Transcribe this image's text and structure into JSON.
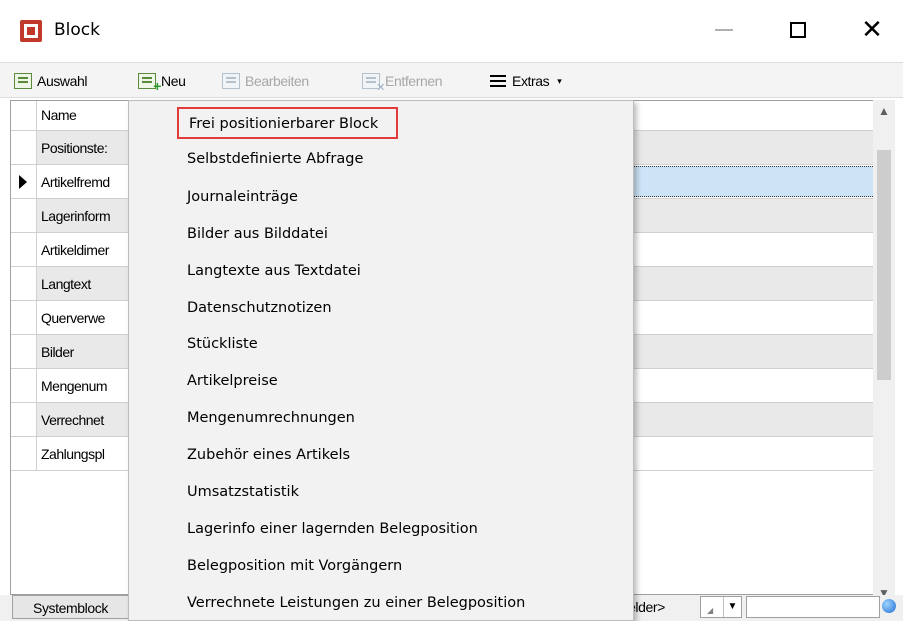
{
  "window": {
    "title": "Block",
    "minimize_label": "Minimize",
    "maximize_label": "Maximize",
    "close_glyph": "✕"
  },
  "toolbar": {
    "items": [
      {
        "label": "Auswahl",
        "icon": "select-icon",
        "enabled": true
      },
      {
        "label": "Neu",
        "icon": "new-icon",
        "enabled": true
      },
      {
        "label": "Bearbeiten",
        "icon": "edit-icon",
        "enabled": false
      },
      {
        "label": "Entfernen",
        "icon": "remove-icon",
        "enabled": false
      },
      {
        "label": "Extras",
        "icon": "menu-icon",
        "enabled": true,
        "has_dropdown": true
      }
    ],
    "extras_caret": "▾"
  },
  "grid": {
    "header": "Name",
    "rows": [
      {
        "name": "Positionste:"
      },
      {
        "name": "Artikelfremd",
        "selected": true
      },
      {
        "name": "Lagerinform"
      },
      {
        "name": "Artikeldimer"
      },
      {
        "name": "Langtext"
      },
      {
        "name": "Querverwe"
      },
      {
        "name": "Bilder"
      },
      {
        "name": "Mengenum"
      },
      {
        "name": "Verrechnet"
      },
      {
        "name": "Zahlungspl"
      }
    ]
  },
  "scroll": {
    "up": "▲",
    "down": "▼"
  },
  "bottom": {
    "systemblock_label": "Systemblock",
    "field_text": "elder>",
    "combo_arrow": "▼",
    "combo_grip": "◢"
  },
  "menu": {
    "items": [
      {
        "label": "Frei positionierbarer Block",
        "highlighted": true
      },
      {
        "label": "Selbstdefinierte Abfrage"
      },
      {
        "label": "Journaleinträge"
      },
      {
        "label": "Bilder aus Bilddatei"
      },
      {
        "label": "Langtexte aus Textdatei"
      },
      {
        "label": "Datenschutznotizen"
      },
      {
        "label": "Stückliste"
      },
      {
        "label": "Artikelpreise"
      },
      {
        "label": "Mengenumrechnungen"
      },
      {
        "label": "Zubehör eines Artikels"
      },
      {
        "label": "Umsatzstatistik"
      },
      {
        "label": "Lagerinfo einer lagernden Belegposition"
      },
      {
        "label": "Belegposition mit Vorgängern"
      },
      {
        "label": "Verrechnete Leistungen zu einer Belegposition"
      }
    ]
  },
  "colors": {
    "highlight_border": "#e23b3b",
    "selected_row": "#cde4f7",
    "alt_row": "#e9e9e9"
  }
}
